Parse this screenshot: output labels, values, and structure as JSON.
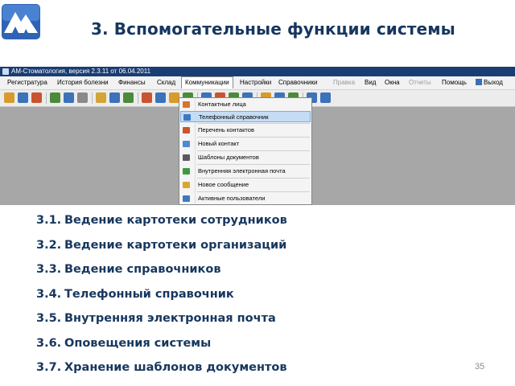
{
  "slide": {
    "title": "3. Вспомогательные функции системы",
    "page_number": "35",
    "logo_icon": "am-mountain-logo-icon"
  },
  "app_window": {
    "title": "АМ-Стоматология, версия 2.3.11 от 06.04.2011",
    "menu": [
      {
        "label": "Регистратура",
        "enabled": true
      },
      {
        "label": "История болезни",
        "enabled": true
      },
      {
        "label": "Финансы",
        "enabled": true
      },
      {
        "label": "Склад",
        "enabled": true
      },
      {
        "label": "Коммуникации",
        "enabled": true,
        "active": true
      },
      {
        "label": "Настройки",
        "enabled": true
      },
      {
        "label": "Справочники",
        "enabled": true
      },
      {
        "label": "Правка",
        "enabled": false
      },
      {
        "label": "Вид",
        "enabled": true
      },
      {
        "label": "Окна",
        "enabled": true
      },
      {
        "label": "Отчеты",
        "enabled": false
      },
      {
        "label": "Помощь",
        "enabled": true
      },
      {
        "label": "Выход",
        "enabled": true,
        "icon": "exit-icon"
      }
    ],
    "dropdown": [
      {
        "label": "Контактные лица",
        "icon": "contacts-icon",
        "color": "#d9742a"
      },
      {
        "label": "Телефонный справочник",
        "icon": "phonebook-icon",
        "color": "#3d78c4",
        "highlighted": true
      },
      {
        "label": "Перечень контактов",
        "icon": "contact-list-icon",
        "color": "#c9542f"
      },
      {
        "label": "Новый контакт",
        "icon": "new-contact-icon",
        "color": "#4f8ad0"
      },
      {
        "label": "Шаблоны документов",
        "icon": "document-templates-icon",
        "color": "#5b5b5b"
      },
      {
        "label": "Внутренняя электронная почта",
        "icon": "internal-mail-icon",
        "color": "#3f9a3f"
      },
      {
        "label": "Новое сообщение",
        "icon": "new-message-icon",
        "color": "#d7a72e"
      },
      {
        "label": "Активные пользователи",
        "icon": "active-users-icon",
        "color": "#3d78c4"
      }
    ],
    "toolbar_icon_colors": [
      "#d79a2b",
      "#3b72b9",
      "#c9542f",
      "#4b8a3b",
      "#3b72b9",
      "#8a8a8a",
      "#d4a437",
      "#3b72b9",
      "#4b8a3b",
      "#c9542f",
      "#3b72b9",
      "#d79a2b",
      "#4b8a3b",
      "#3b72b9",
      "#c9542f",
      "#4b8a3b",
      "#3b72b9",
      "#d79a2b",
      "#3b72b9",
      "#4b8a3b",
      "#3b72b9",
      "#3b72b9"
    ]
  },
  "items": [
    {
      "num": "3.1.",
      "text": "Ведение картотеки сотрудников"
    },
    {
      "num": "3.2.",
      "text": "Ведение картотеки организаций"
    },
    {
      "num": "3.3.",
      "text": "Ведение справочников"
    },
    {
      "num": "3.4.",
      "text": "Телефонный справочник"
    },
    {
      "num": "3.5.",
      "text": "Внутренняя электронная почта"
    },
    {
      "num": "3.6.",
      "text": "Оповещения системы"
    },
    {
      "num": "3.7.",
      "text": "Хранение шаблонов документов"
    }
  ],
  "colors": {
    "title": "#17375e",
    "app_titlebar": "#1a3d73",
    "app_background": "#a7a7a7",
    "highlight": "#c5dcf5",
    "logo": "#2f63b4"
  }
}
